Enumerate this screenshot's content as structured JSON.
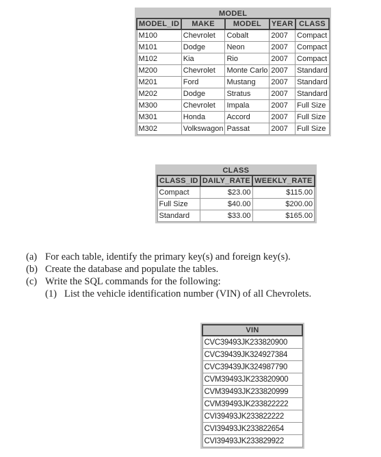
{
  "model_table": {
    "title": "MODEL",
    "headers": [
      "MODEL_ID",
      "MAKE",
      "MODEL",
      "YEAR",
      "CLASS"
    ],
    "rows": [
      [
        "M100",
        "Chevrolet",
        "Cobalt",
        "2007",
        "Compact"
      ],
      [
        "M101",
        "Dodge",
        "Neon",
        "2007",
        "Compact"
      ],
      [
        "M102",
        "Kia",
        "Rio",
        "2007",
        "Compact"
      ],
      [
        "M200",
        "Chevrolet",
        "Monte Carlo",
        "2007",
        "Standard"
      ],
      [
        "M201",
        "Ford",
        "Mustang",
        "2007",
        "Standard"
      ],
      [
        "M202",
        "Dodge",
        "Stratus",
        "2007",
        "Standard"
      ],
      [
        "M300",
        "Chevrolet",
        "Impala",
        "2007",
        "Full Size"
      ],
      [
        "M301",
        "Honda",
        "Accord",
        "2007",
        "Full Size"
      ],
      [
        "M302",
        "Volkswagon",
        "Passat",
        "2007",
        "Full Size"
      ]
    ]
  },
  "class_table": {
    "title": "CLASS",
    "headers": [
      "CLASS_ID",
      "DAILY_RATE",
      "WEEKLY_RATE"
    ],
    "rows": [
      [
        "Compact",
        "$23.00",
        "$115.00"
      ],
      [
        "Full Size",
        "$40.00",
        "$200.00"
      ],
      [
        "Standard",
        "$33.00",
        "$165.00"
      ]
    ]
  },
  "questions": [
    {
      "label": "(a)",
      "text": "For each table, identify the primary key(s) and foreign key(s)."
    },
    {
      "label": "(b)",
      "text": "Create the database and populate the tables."
    },
    {
      "label": "(c)",
      "text": "Write the SQL commands for the following:"
    },
    {
      "label": "(1)",
      "text": "List the vehicle identification number (VIN) of all Chevrolets."
    }
  ],
  "vin_table": {
    "header": "VIN",
    "rows": [
      "CVC39493JK233820900",
      "CVC39439JK324927384",
      "CVC39439JK324987790",
      "CVM39493JK233820900",
      "CVM39493JK233820999",
      "CVM39493JK233822222",
      "CVI39493JK233822222",
      "CVI39493JK233822654",
      "CVI39493JK233829922"
    ]
  }
}
